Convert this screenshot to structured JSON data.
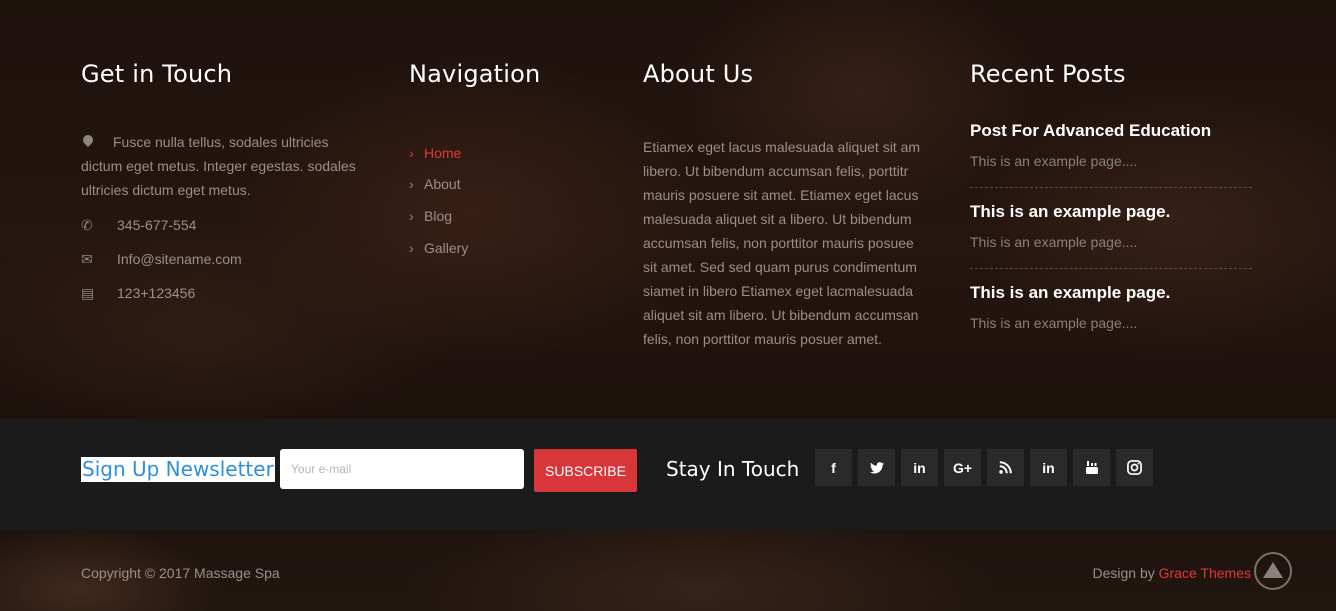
{
  "get_in_touch": {
    "title": "Get in Touch",
    "address": "Fusce nulla tellus, sodales ultricies dictum eget metus. Integer egestas. sodales ultricies dictum eget metus.",
    "phone": "345-677-554",
    "email": "Info@sitename.com",
    "fax": "123+123456"
  },
  "navigation": {
    "title": "Navigation",
    "items": [
      {
        "label": "Home",
        "active": true
      },
      {
        "label": "About",
        "active": false
      },
      {
        "label": "Blog",
        "active": false
      },
      {
        "label": "Gallery",
        "active": false
      }
    ]
  },
  "about": {
    "title": "About Us",
    "text": "Etiamex eget lacus malesuada aliquet sit am libero. Ut bibendum accumsan felis, porttitr mauris posuere sit amet. Etiamex eget lacus malesuada aliquet sit a libero. Ut bibendum accumsan felis, non porttitor mauris posuee sit amet. Sed sed quam purus condimentum siamet in libero Etiamex eget lacmalesuada aliquet sit am libero. Ut bibendum accumsan felis, non porttitor mauris posuer amet."
  },
  "recent_posts": {
    "title": "Recent Posts",
    "posts": [
      {
        "title": "Post For Advanced Education",
        "excerpt": "This is an example page...."
      },
      {
        "title": "This is an example page.",
        "excerpt": "This is an example page...."
      },
      {
        "title": "This is an example page.",
        "excerpt": "This is an example page...."
      }
    ]
  },
  "newsletter": {
    "title": "Sign Up Newsletter",
    "email_placeholder": "Your e-mail",
    "subscribe_label": "SUBSCRIBE",
    "stay_in_touch": "Stay In Touch",
    "social": [
      {
        "icon": "facebook-icon",
        "glyph": "f"
      },
      {
        "icon": "twitter-icon",
        "glyph": "🐦"
      },
      {
        "icon": "linkedin-icon",
        "glyph": "in"
      },
      {
        "icon": "google-plus-icon",
        "glyph": "G+"
      },
      {
        "icon": "rss-icon",
        "glyph": "◔"
      },
      {
        "icon": "linkedin-icon",
        "glyph": "in"
      },
      {
        "icon": "youtube-icon",
        "glyph": "▶"
      },
      {
        "icon": "instagram-icon",
        "glyph": "◎"
      }
    ]
  },
  "footer": {
    "copyright": "Copyright © 2017 Massage Spa",
    "design_by": "Design by",
    "theme_link": "Grace Themes"
  },
  "colors": {
    "accent": "#e03838",
    "newsletter_title": "#2e8fe0",
    "bar_bg": "#1b1b1b"
  }
}
